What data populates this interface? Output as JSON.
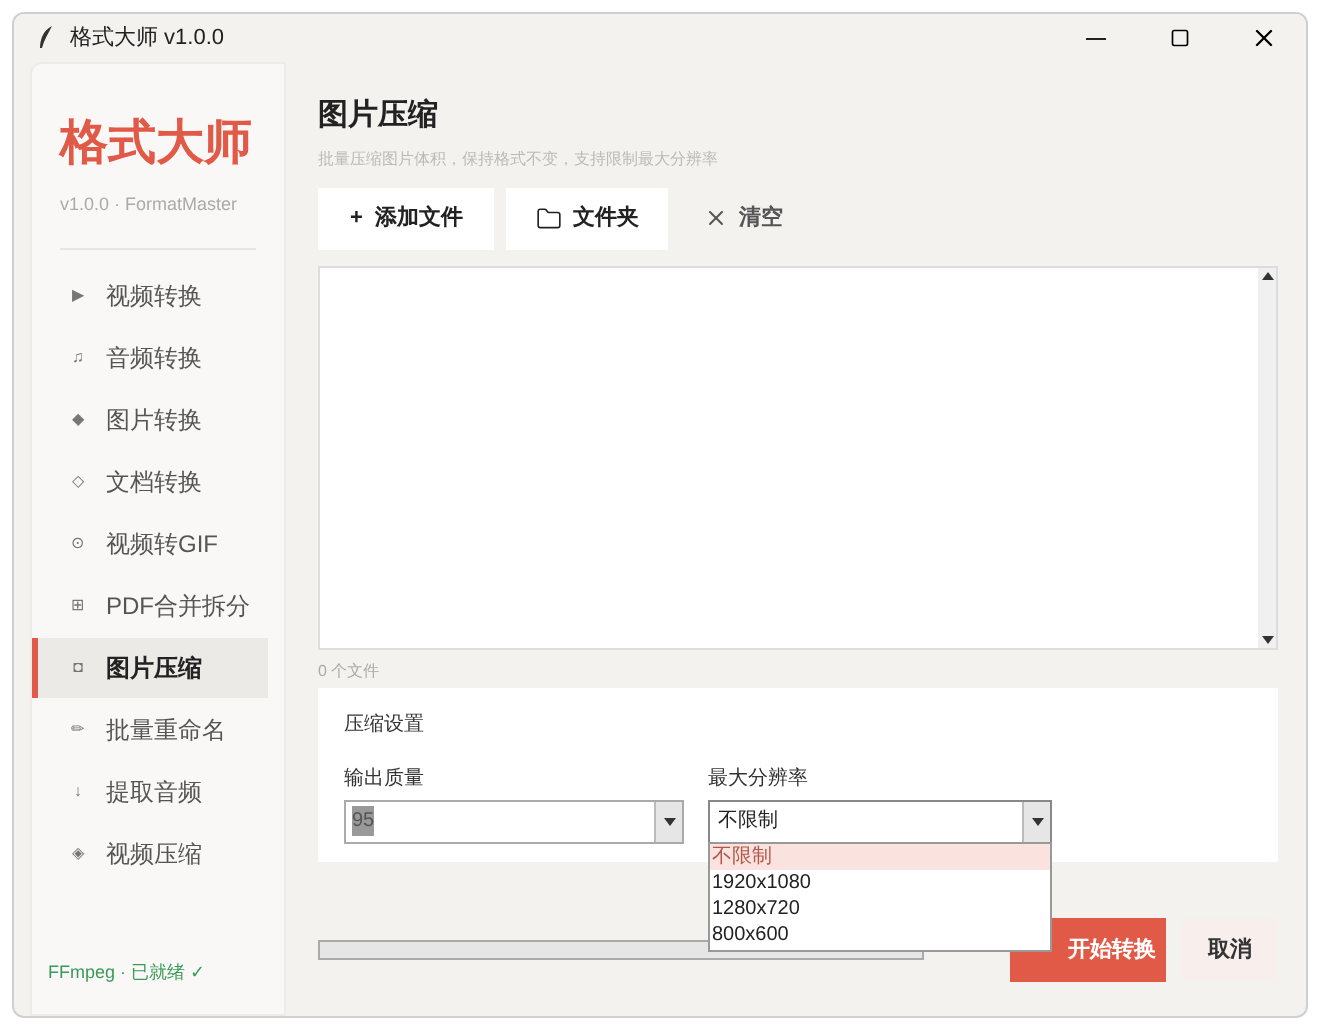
{
  "window": {
    "title": "格式大师 v1.0.0"
  },
  "sidebar": {
    "logo": "格式大师",
    "version": "v1.0.0 · FormatMaster",
    "items": [
      {
        "icon": "▶",
        "label": "视频转换",
        "selected": false
      },
      {
        "icon": "♫",
        "label": "音频转换",
        "selected": false
      },
      {
        "icon": "◆",
        "label": "图片转换",
        "selected": false
      },
      {
        "icon": "◇",
        "label": "文档转换",
        "selected": false
      },
      {
        "icon": "⊙",
        "label": "视频转GIF",
        "selected": false
      },
      {
        "icon": "⊞",
        "label": "PDF合并拆分",
        "selected": false
      },
      {
        "icon": "◘",
        "label": "图片压缩",
        "selected": true
      },
      {
        "icon": "✏",
        "label": "批量重命名",
        "selected": false
      },
      {
        "icon": "↓",
        "label": "提取音频",
        "selected": false
      },
      {
        "icon": "◈",
        "label": "视频压缩",
        "selected": false
      }
    ],
    "status": "FFmpeg · 已就绪 ✓"
  },
  "page": {
    "title": "图片压缩",
    "subtitle": "批量压缩图片体积，保持格式不变，支持限制最大分辨率"
  },
  "toolbar": [
    {
      "kind": "add",
      "icon": "+",
      "label": "添加文件"
    },
    {
      "kind": "folder",
      "label": "文件夹"
    },
    {
      "kind": "clear",
      "label": "清空"
    }
  ],
  "file_count": "0 个文件",
  "settings": {
    "title": "压缩设置",
    "quality": {
      "label": "输出质量",
      "value": "95"
    },
    "resolution": {
      "label": "最大分辨率",
      "value": "不限制",
      "expanded": true,
      "options": [
        {
          "label": "不限制",
          "selected": true
        },
        {
          "label": "1920x1080",
          "selected": false
        },
        {
          "label": "1280x720",
          "selected": false
        },
        {
          "label": "800x600",
          "selected": false
        }
      ]
    }
  },
  "buttons": {
    "start": "开始转换",
    "cancel": "取消"
  }
}
